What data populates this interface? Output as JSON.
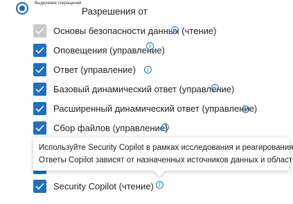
{
  "radio": {
    "small_label": "Выделение сокращений",
    "selected": true
  },
  "group": {
    "title": "Разрешения от"
  },
  "permissions": [
    {
      "label": "Основы безопасности данных (чтение)",
      "checked": true,
      "disabled": true
    },
    {
      "label": "Оповещения (управление)",
      "checked": true,
      "disabled": false
    },
    {
      "label": "Ответ (управление)",
      "checked": true,
      "disabled": false
    },
    {
      "label": "Базовый динамический ответ (управление)",
      "checked": true,
      "disabled": false
    },
    {
      "label": "Расширенный динамический ответ (управление)",
      "checked": true,
      "disabled": false
    },
    {
      "label": "Сбор файлов (управление)",
      "checked": true,
      "disabled": false
    },
    {
      "label": "Security Copilot (чтение)",
      "checked": true,
      "disabled": false
    }
  ],
  "tooltip": {
    "line1": "Используйте Security Copilot в рамках исследования и реагирования.",
    "line2": "Ответы Copilot зависят от назначенных источников данных и область"
  },
  "info_icon_glyph": "i",
  "colors": {
    "accent": "#1f6fc5",
    "disabled": "#c8c8c8",
    "radio": "#0f6cbd"
  }
}
